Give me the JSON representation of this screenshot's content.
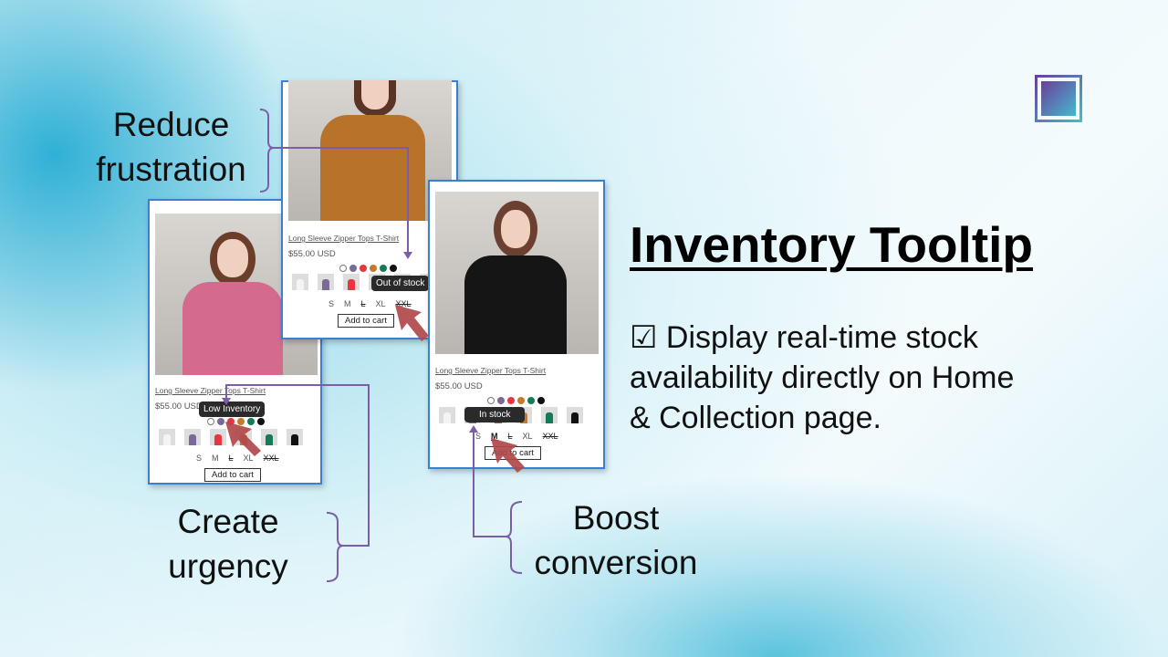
{
  "headline": "Inventory Tooltip",
  "description": "☑ Display real-time stock availability directly on Home & Collection page.",
  "description_lines": [
    "☑ Display real-time stock",
    "availability directly on Home",
    "& Collection page."
  ],
  "annotations": {
    "reduce": [
      "Reduce",
      "frustration"
    ],
    "urgency": [
      "Create",
      "urgency"
    ],
    "boost": [
      "Boost",
      "conversion"
    ]
  },
  "accent_color": "#7b5ea7",
  "swatch_colors": [
    "#ffffff",
    "#7a6a9a",
    "#e8363e",
    "#c47a2c",
    "#137a5a",
    "#111111"
  ],
  "sizes": [
    "S",
    "M",
    "L",
    "XL",
    "XXL"
  ],
  "cards": [
    {
      "title": "Long Sleeve Zipper Tops T-Shirt",
      "price": "$55.00 USD",
      "tooltip": "Low Inventory",
      "add_to_cart": "Add to cart",
      "shirt_color": "#d46a8e"
    },
    {
      "title": "Long Sleeve Zipper Tops T-Shirt",
      "price": "$55.00 USD",
      "tooltip": "Out of stock",
      "add_to_cart": "Add to cart",
      "shirt_color": "#b8732a"
    },
    {
      "title": "Long Sleeve Zipper Tops T-Shirt",
      "price": "$55.00 USD",
      "tooltip": "In stock",
      "add_to_cart": "Add to cart",
      "shirt_color": "#151515"
    }
  ],
  "logo_icon": "grid-app-icon"
}
